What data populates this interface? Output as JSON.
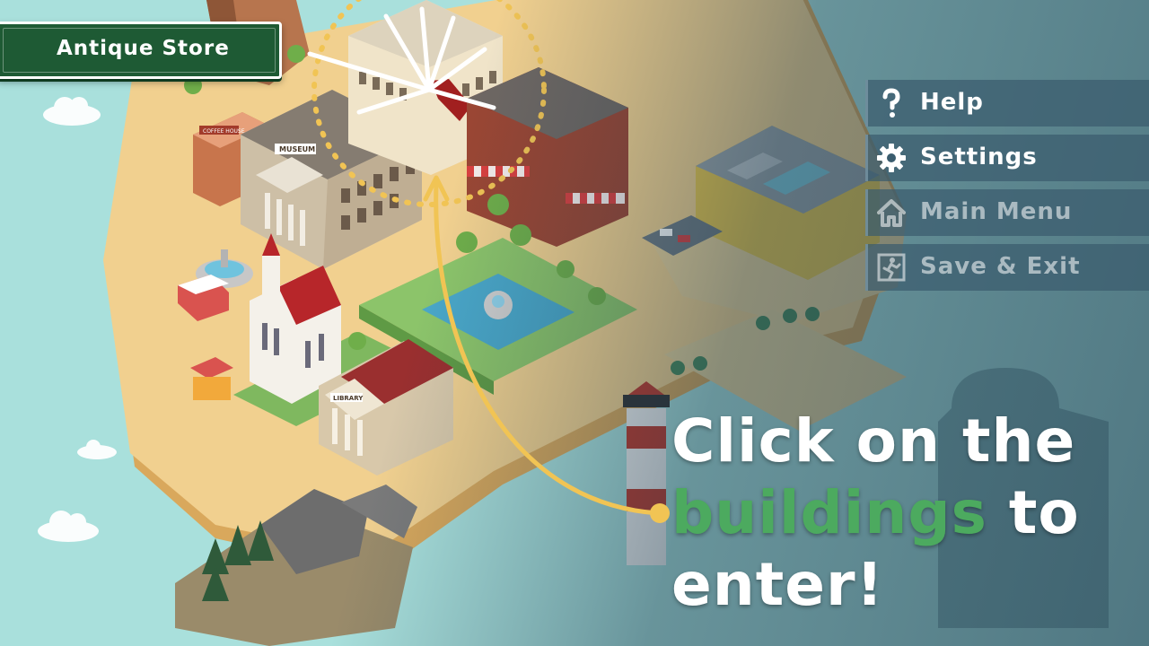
{
  "location_sign": {
    "label": "Antique Store"
  },
  "menu": {
    "items": [
      {
        "label": "Help",
        "icon": "help-icon",
        "dim": false
      },
      {
        "label": "Settings",
        "icon": "gear-icon",
        "dim": false
      },
      {
        "label": "Main Menu",
        "icon": "home-icon",
        "dim": true
      },
      {
        "label": "Save & Exit",
        "icon": "exit-icon",
        "dim": true
      }
    ]
  },
  "tutorial": {
    "line1": "Click on the",
    "highlight": "buildings",
    "line2_rest": " to",
    "line3": "enter!"
  },
  "map_labels": {
    "museum": "MUSEUM",
    "library": "LIBRARY",
    "coffee": "COFFEE HOUSE"
  },
  "colors": {
    "sea": "#a9e0dc",
    "sand": "#f1d08f",
    "sign_green": "#1e5a34",
    "highlight_green": "#4caa5f",
    "arrow_gold": "#f1c454"
  }
}
